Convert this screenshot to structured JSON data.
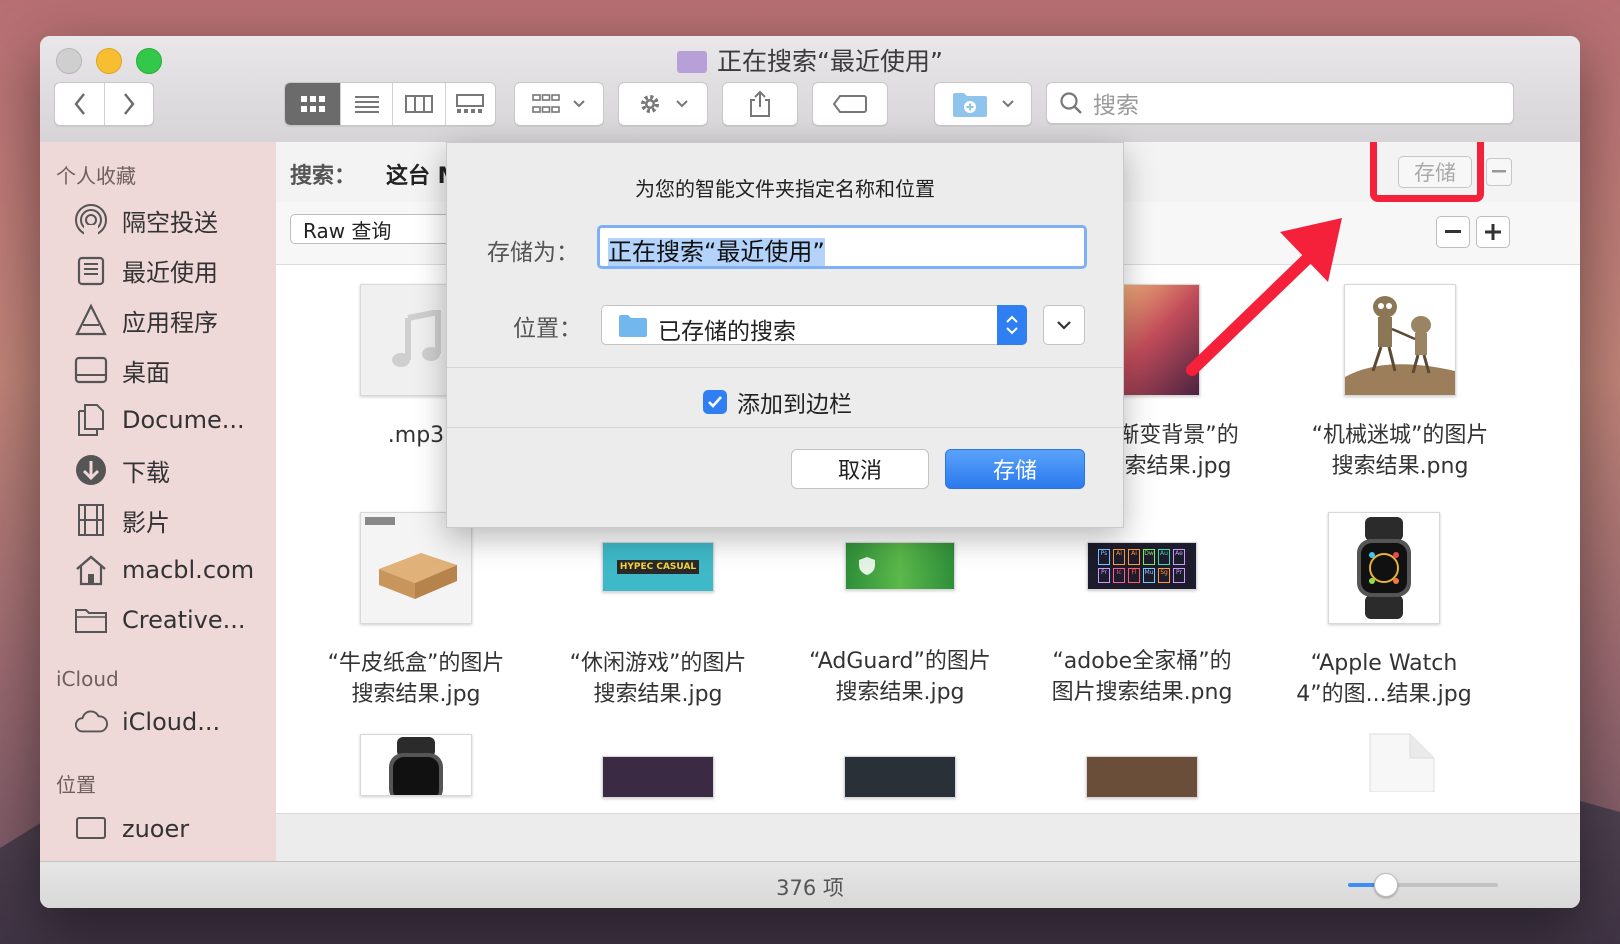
{
  "window": {
    "title": "正在搜索“最近使用”"
  },
  "toolbar": {
    "search_placeholder": "搜索"
  },
  "sidebar": {
    "favorites_header": "个人收藏",
    "favorites": [
      {
        "label": "隔空投送",
        "icon": "airdrop-icon"
      },
      {
        "label": "最近使用",
        "icon": "recents-icon"
      },
      {
        "label": "应用程序",
        "icon": "applications-icon"
      },
      {
        "label": "桌面",
        "icon": "desktop-icon"
      },
      {
        "label": "Docume...",
        "icon": "documents-icon"
      },
      {
        "label": "下载",
        "icon": "downloads-icon"
      },
      {
        "label": "影片",
        "icon": "movies-icon"
      },
      {
        "label": "macbl.com",
        "icon": "home-icon"
      },
      {
        "label": "Creative...",
        "icon": "folder-icon"
      }
    ],
    "icloud_header": "iCloud",
    "icloud_item": "iCloud...",
    "locations_header": "位置",
    "location_item": "zuoer"
  },
  "search": {
    "scope_label": "搜索：",
    "scope_value": "这台 M",
    "save_button": "存储",
    "criteria_value": "Raw 查询"
  },
  "files": [
    {
      "caption_line1": ".mp3",
      "caption_line2": ""
    },
    {
      "caption_line1": "渐变背景”的",
      "caption_line2": "索结果.jpg"
    },
    {
      "caption_line1": "“机械迷城”的图片",
      "caption_line2": "搜索结果.png"
    },
    {
      "caption_line1": "“牛皮纸盒”的图片",
      "caption_line2": "搜索结果.jpg"
    },
    {
      "caption_line1": "“休闲游戏”的图片",
      "caption_line2": "搜索结果.jpg"
    },
    {
      "caption_line1": "“AdGuard”的图片",
      "caption_line2": "搜索结果.jpg"
    },
    {
      "caption_line1": "“adobe全家桶”的",
      "caption_line2": "图片搜索结果.png"
    },
    {
      "caption_line1": "“Apple Watch",
      "caption_line2": "4”的图...结果.jpg"
    }
  ],
  "thumb_text": {
    "hypec": "HYPEC CASUAL",
    "adobe_apps": [
      "Ps",
      "Ai",
      "Ai",
      "Dw",
      "Au",
      "Ae",
      "Pr",
      "Ic",
      "Fl",
      "Mu",
      "Sg",
      "Pr"
    ]
  },
  "status": {
    "count": "376 项",
    "zoom_slider_value": 0.25
  },
  "dialog": {
    "title": "为您的智能文件夹指定名称和位置",
    "save_as_label": "存储为：",
    "save_as_value": "正在搜索“最近使用”",
    "location_label": "位置：",
    "location_value": "已存储的搜索",
    "add_to_sidebar_label": "添加到边栏",
    "add_to_sidebar_checked": true,
    "cancel_button": "取消",
    "save_button": "存储"
  },
  "annotation": {
    "highlight_color": "#f5213a"
  }
}
